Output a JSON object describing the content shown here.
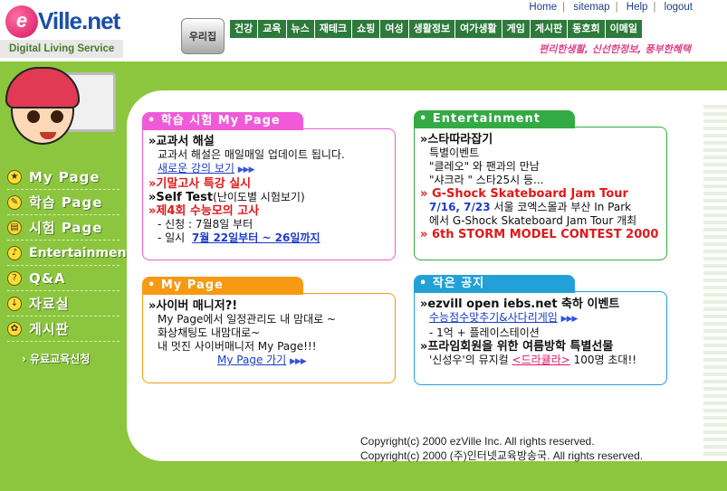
{
  "header": {
    "logo_e": "e",
    "logo_text": "Ville.net",
    "tagline": "Digital Living Service",
    "home_button": "우리집",
    "slogan": "편리한생활, 신선한정보, 풍부한혜택"
  },
  "top_links": [
    "Home",
    "sitemap",
    "Help",
    "logout"
  ],
  "nav": [
    "건강",
    "교육",
    "뉴스",
    "재테크",
    "쇼핑",
    "여성",
    "생활정보",
    "여가생활",
    "게임",
    "게시판",
    "동호회",
    "이메일"
  ],
  "sidebar": {
    "items": [
      {
        "label": "My Page",
        "icon": "star-icon"
      },
      {
        "label": "학습 Page",
        "icon": "pencil-icon"
      },
      {
        "label": "시험 Page",
        "icon": "book-icon"
      },
      {
        "label": "Entertainment",
        "icon": "music-icon"
      },
      {
        "label": "Q&A",
        "icon": "question-icon"
      },
      {
        "label": "자료실",
        "icon": "download-icon"
      },
      {
        "label": "게시판",
        "icon": "flower-icon"
      }
    ],
    "apply_link": "유료교육신청"
  },
  "study_box": {
    "title": "학습 시험 My Page",
    "item1_head": "교과서 해설",
    "item1_desc": "교과서 해설은 매일매일 업데이트 됩니다.",
    "item1_link": "새로운 강의 보기",
    "item2": "기말고사 특강 실시",
    "item3_prefix": "Self Test",
    "item3_suffix": "(난이도별 시험보기)",
    "item4": "제4회 수능모의 고사",
    "apply_label": "- 신청 : 7월8일 부터",
    "date_label": "- 일시",
    "date_value": "7월 22일부터 ~ 26일까지"
  },
  "ent_box": {
    "title": "Entertainment",
    "item1_head": "스타따라잡기",
    "item1_l1": "특별이벤트",
    "item1_l2": "\"클레오\" 와 팬과의 만남",
    "item1_l3": "\"샤크라 \" 스타25시 등...",
    "item2_head": "G-Shock Skateboard Jam Tour",
    "item2_date": "7/16, 7/23",
    "item2_l1": " 서울 코엑스몰과 부산 In Park",
    "item2_l2": "에서 G-Shock Skateboard Jam Tour 개최",
    "item3": "6th STORM MODEL CONTEST 2000"
  },
  "mypage_box": {
    "title": "My Page",
    "head": "사이버 매니저?!",
    "l1": "My Page에서 일정관리도 내 맘대로 ~",
    "l2": "화상채팅도 내맘대로~",
    "l3": "내 멋진 사이버매니저 My Page!!!",
    "link": "My Page 가기"
  },
  "notice_box": {
    "title": "작은 공지",
    "item1_head": "ezvill open iebs.net 축하 이벤트",
    "item1_link": "수능점수맞추기&사다리게임",
    "item1_l2": "- 1억 + 플레이스테이션",
    "item2_head": "프라임회원을 위한 여름방학 특별선물",
    "item2_pre": "'신성우'의 뮤지컬 ",
    "item2_link": "<드라큘라>",
    "item2_post": " 100명 초대!!"
  },
  "copyright": {
    "line1": "Copyright(c) 2000 ezVille Inc. All rights reserved.",
    "line2": "Copyright(c) 2000 (주)인터넷교육방송국. All rights reserved."
  },
  "colors": {
    "background": "#8cc63f",
    "study_tab": "#f05ad8",
    "ent_tab": "#33aa44",
    "mypage_tab": "#f59a12",
    "notice_tab": "#22a0d8",
    "nav_bg": "#2d7a3a"
  }
}
